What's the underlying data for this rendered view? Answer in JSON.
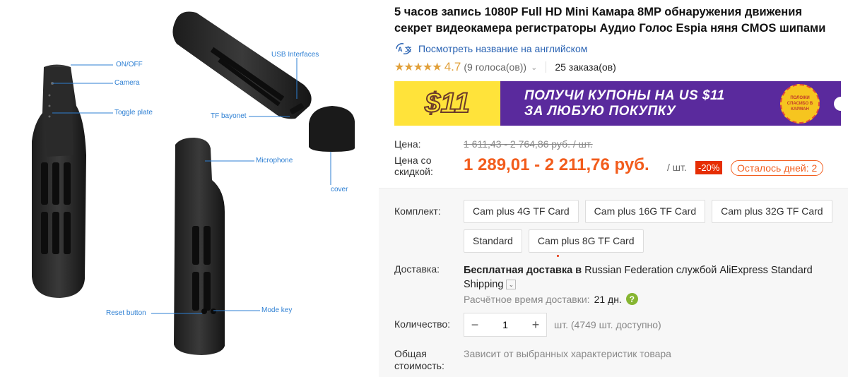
{
  "gallery": {
    "callouts": {
      "onoff": "ON/OFF",
      "camera": "Camera",
      "toggle": "Toggle plate",
      "usb": "USB Interfaces",
      "tf": "TF bayonet",
      "microphone": "Microphone",
      "cover": "cover",
      "reset": "Reset button",
      "mode": "Mode key"
    }
  },
  "product": {
    "title": "5 часов запись 1080P Full HD Mini Камара 8MP обнаружения движения секрет видеокамера регистраторы Аудио Голос Espia няня CMOS шипами",
    "translate_link": "Посмотреть название на английском",
    "translate_icon": "translate-icon",
    "rating": {
      "stars": "★★★★★",
      "value": "4.7",
      "votes": "(9 голоса(ов))"
    },
    "orders": "25 заказа(ов)"
  },
  "banner": {
    "amount": "$11",
    "line1": "ПОЛУЧИ КУПОНЫ НА US $11",
    "line2": "ЗА ЛЮБУЮ ПОКУПКУ",
    "badge": "ПОЛОЖИ СПАСИБО В КАРМАН"
  },
  "price": {
    "label": "Цена:",
    "original": "1 611,43 - 2 764,86 руб. / шт.",
    "discount_label": "Цена со скидкой:",
    "current": "1 289,01 - 2 211,76 руб.",
    "per_unit": "/ шт.",
    "discount_badge": "-20%",
    "days_left": "Осталось дней: 2",
    "accent_color": "#f25c1c"
  },
  "options": {
    "label": "Комплект:",
    "items": [
      "Cam plus 4G TF Card",
      "Cam plus 16G TF Card",
      "Cam plus 32G TF Card",
      "Standard",
      "Cam plus 8G TF Card"
    ]
  },
  "shipping": {
    "label": "Доставка:",
    "bold_part": "Бесплатная доставка в",
    "rest": " Russian Federation службой AliExpress Standard Shipping",
    "eta_label": "Расчётное время доставки:",
    "eta_value": "21 дн.",
    "help": "?"
  },
  "quantity": {
    "label": "Количество:",
    "minus": "−",
    "value": "1",
    "plus": "+",
    "note": "шт. (4749 шт. доступно)"
  },
  "total": {
    "label": "Общая стоимость:",
    "note": "Зависит от выбранных характеристик товара"
  }
}
